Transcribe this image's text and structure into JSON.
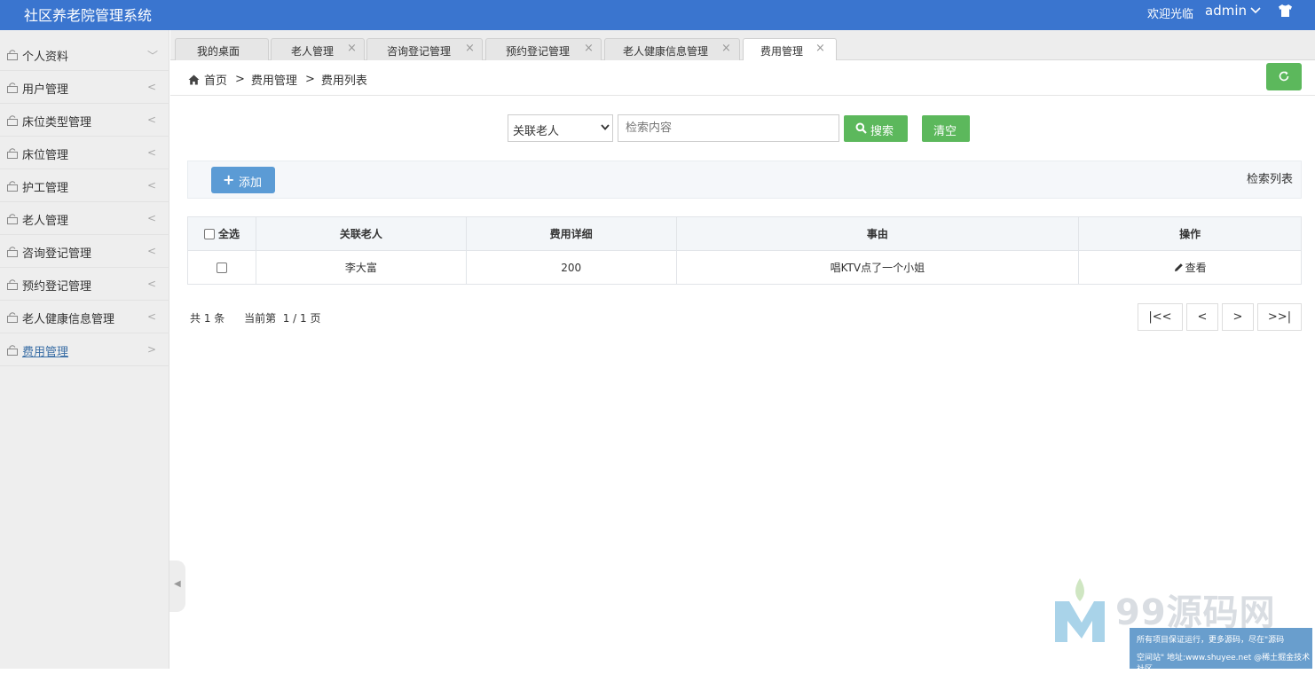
{
  "app": {
    "title": "社区养老院管理系统",
    "welcome": "欢迎光临",
    "username": "admin"
  },
  "sidebar": {
    "items": [
      {
        "label": "个人资料",
        "arrow": "﹀"
      },
      {
        "label": "用户管理",
        "arrow": "<"
      },
      {
        "label": "床位类型管理",
        "arrow": "<"
      },
      {
        "label": "床位管理",
        "arrow": "<"
      },
      {
        "label": "护工管理",
        "arrow": "<"
      },
      {
        "label": "老人管理",
        "arrow": "<"
      },
      {
        "label": "咨询登记管理",
        "arrow": "<"
      },
      {
        "label": "预约登记管理",
        "arrow": "<"
      },
      {
        "label": "老人健康信息管理",
        "arrow": "<"
      },
      {
        "label": "费用管理",
        "arrow": ">"
      }
    ]
  },
  "tabs": [
    {
      "label": "我的桌面",
      "close": ""
    },
    {
      "label": "老人管理",
      "close": "×"
    },
    {
      "label": "咨询登记管理",
      "close": "×"
    },
    {
      "label": "预约登记管理",
      "close": "×"
    },
    {
      "label": "老人健康信息管理",
      "close": "×"
    },
    {
      "label": "费用管理",
      "close": "×"
    }
  ],
  "breadcrumb": {
    "home": "首页",
    "sep": ">",
    "level1": "费用管理",
    "level2": "费用列表"
  },
  "search": {
    "field_selected": "关联老人",
    "placeholder": "检索内容",
    "search_label": "搜索",
    "clear_label": "清空"
  },
  "toolbar": {
    "add_label": "添加",
    "right_title": "检索列表"
  },
  "table": {
    "select_all": "全选",
    "columns": [
      "关联老人",
      "费用详细",
      "事由",
      "操作"
    ],
    "rows": [
      {
        "elder": "李大富",
        "fee": "200",
        "reason": "唱KTV点了一个小姐",
        "action": "查看"
      }
    ]
  },
  "pager": {
    "total": "共 1 条",
    "current": "当前第  1 / 1 页",
    "first": "|<<",
    "prev": "<",
    "next": ">",
    "last": ">>|"
  },
  "watermark": {
    "brand": "99源码网",
    "line1": "所有项目保证运行，更多源码，尽在\"源码",
    "line2": "空间站\" 地址:www.shuyee.net  @稀土掘金技术社区"
  }
}
